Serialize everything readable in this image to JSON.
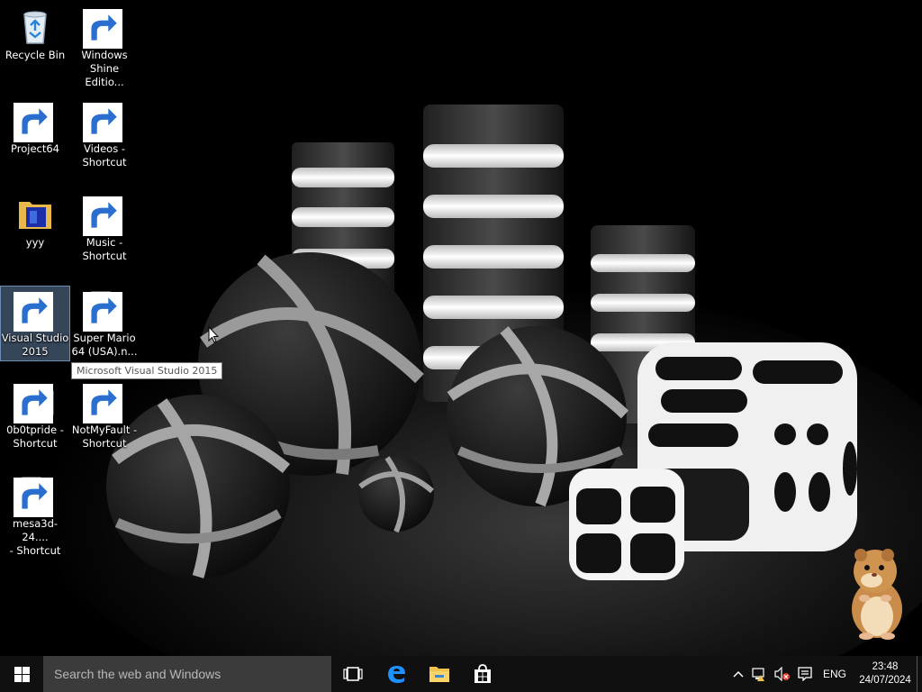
{
  "desktop": {
    "icons": [
      {
        "label": "Recycle Bin",
        "icon": "recycle-bin-icon",
        "shortcut": false
      },
      {
        "label": "Windows\nShine Editio...",
        "icon": "windows-shine-icon",
        "shortcut": true
      },
      {
        "label": "Project64",
        "icon": "project64-icon",
        "shortcut": true
      },
      {
        "label": "Videos -\nShortcut",
        "icon": "videos-folder-icon",
        "shortcut": true
      },
      {
        "label": "yyy",
        "icon": "folder-icon",
        "shortcut": false
      },
      {
        "label": "Music -\nShortcut",
        "icon": "music-folder-icon",
        "shortcut": true
      },
      {
        "label": "Visual Studio\n2015",
        "icon": "visual-studio-icon",
        "shortcut": false,
        "selected": true
      },
      {
        "label": "Super Mario\n64 (USA).n...",
        "icon": "file-icon",
        "shortcut": true
      },
      {
        "label": "0b0tpride -\nShortcut",
        "icon": "image-icon",
        "shortcut": true
      },
      {
        "label": "NotMyFault -\nShortcut",
        "icon": "zip-folder-icon",
        "shortcut": true
      },
      {
        "label": "mesa3d-24....\n- Shortcut",
        "icon": "file-icon",
        "shortcut": true
      }
    ],
    "tooltip": "Microsoft Visual Studio 2015"
  },
  "taskbar": {
    "search_placeholder": "Search the web and Windows",
    "pinned": [
      {
        "name": "task-view-icon"
      },
      {
        "name": "edge-icon"
      },
      {
        "name": "file-explorer-icon"
      },
      {
        "name": "store-icon"
      }
    ],
    "tray": {
      "language": "ENG",
      "time": "23:48",
      "date": "24/07/2024"
    }
  },
  "colors": {
    "taskbar": "#101010",
    "search_box": "#3b3b3b",
    "accent": "#1e90ff",
    "visual_studio": "#68217a"
  }
}
